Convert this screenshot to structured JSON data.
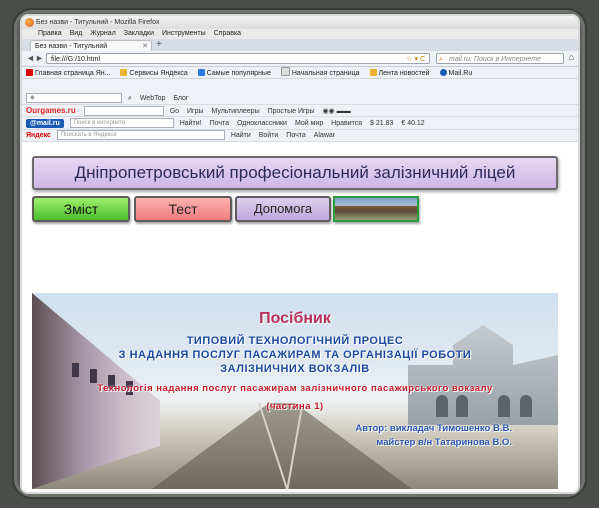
{
  "window": {
    "title": "Без назви - Титульний - Mozilla Firefox",
    "menu": [
      "Правка",
      "Вид",
      "Журнал",
      "Закладки",
      "Инструменты",
      "Справка"
    ],
    "tab_label": "Без назви - Титульний",
    "new_tab": "+"
  },
  "nav": {
    "back": "◄",
    "forward": "►",
    "url": "file:///G:/10.html",
    "search_placeholder": "mail.ru: Поиск в Интернете"
  },
  "bookmarks": [
    "Главная страница Ян...",
    "Сервисы Яндекса",
    "Самые популярные",
    "Начальная страница",
    "Лента новостей",
    "Mail.Ru"
  ],
  "toolbars": {
    "webtop": "WebTop",
    "blog": "Блог",
    "ourgames": "Ourgames.ru",
    "go": "Go",
    "games": "Игры",
    "multiplayer": "Мультиплееры",
    "simple_games": "Простые Игры",
    "mailru": "@mail.ru",
    "mail_search": "Поиск в интернете",
    "find": "Найти!",
    "pochta": "Почта",
    "odnoklassniki": "Одноклассники",
    "moy_mir": "Мой мир",
    "like": "Нравится",
    "usd": "21.83",
    "eur": "40.12",
    "yandex": "Яндекс",
    "yandex_search": "Поискать в Яндексе",
    "yfind": "Найти",
    "vojti": "Войти",
    "ypochta": "Почта",
    "alawar": "Alawar"
  },
  "page": {
    "header": "Дніпропетровський професіональний залізничний ліцей",
    "buttons": {
      "zmist": "Зміст",
      "test": "Тест",
      "help": "Допомога"
    },
    "banner": {
      "title": "Посібник",
      "line1": "ТИПОВИЙ ТЕХНОЛОГІЧНИЙ ПРОЦЕС",
      "line2": "З НАДАННЯ ПОСЛУГ ПАСАЖИРАМ ТА ОРГАНІЗАЦІЇ РОБОТИ",
      "line3": "ЗАЛІЗНИЧНИХ ВОКЗАЛІВ",
      "subtitle": "Технологія надання послуг пасажирам залізничного пасажирського вокзалу",
      "part": "(частина 1)",
      "author1": "Автор: викладач Тимошенко В.В.",
      "author2": "майстер в/н Татаринова В.О."
    }
  },
  "colors": {
    "header_bg": "#cdb6e6",
    "zmist_bg": "#49bf2c",
    "test_bg": "#ef7d7d",
    "help_bg": "#bda8dc",
    "title_color": "#b8315a",
    "banner_text": "#1c4a9e",
    "banner_red": "#c41a2a"
  }
}
